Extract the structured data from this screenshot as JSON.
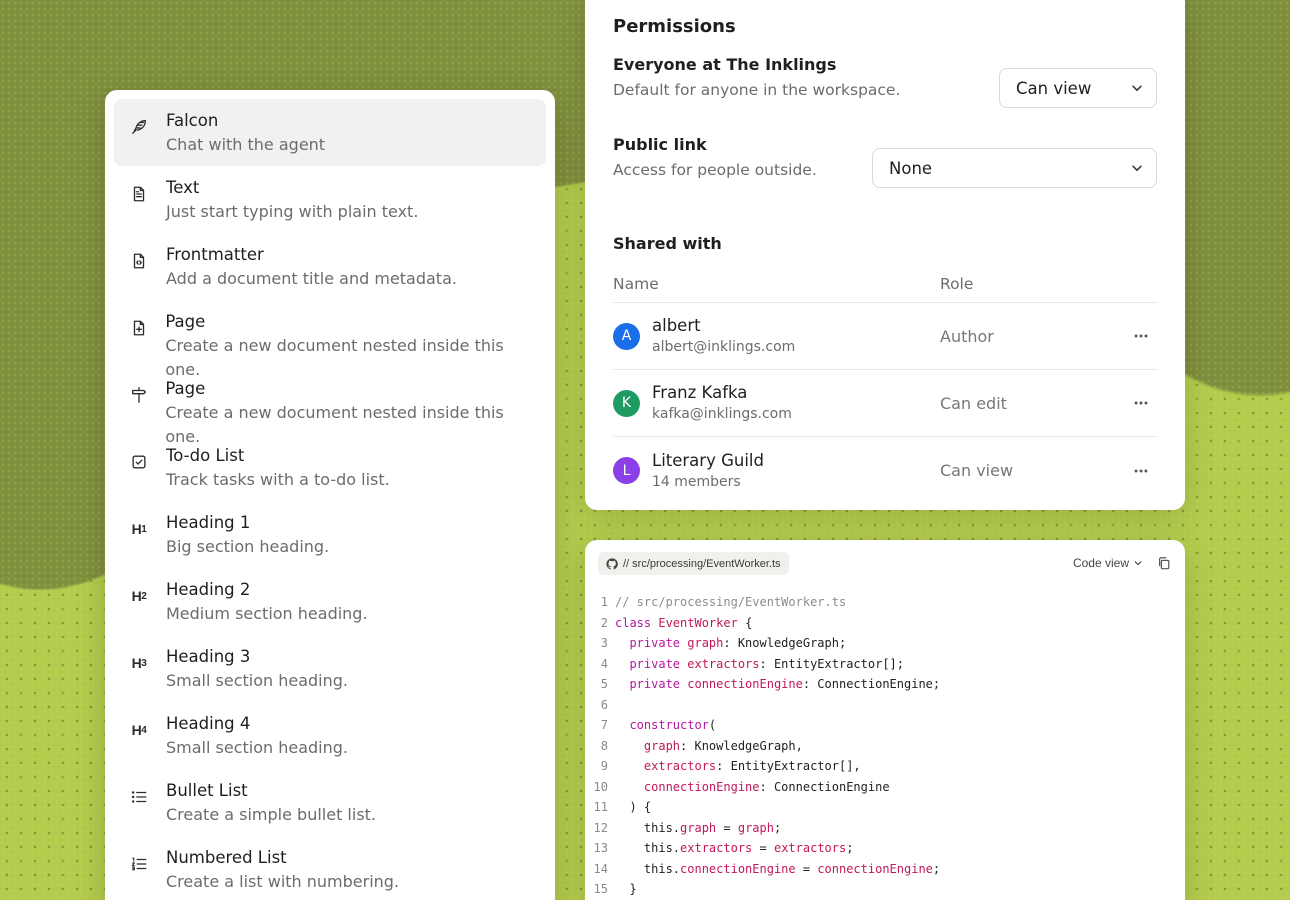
{
  "menu": {
    "items": [
      {
        "title": "Falcon",
        "desc": "Chat with the agent",
        "icon": "feather-icon",
        "active": true
      },
      {
        "title": "Text",
        "desc": "Just start typing with plain text.",
        "icon": "document-text-icon"
      },
      {
        "title": "Frontmatter",
        "desc": "Add a document title and metadata.",
        "icon": "document-code-icon"
      },
      {
        "title": "Page",
        "desc": "Create a new document nested inside this one.",
        "icon": "document-plus-icon"
      },
      {
        "title": "Page",
        "desc": "Create a new document nested inside this one.",
        "icon": "signpost-icon"
      },
      {
        "title": "To-do List",
        "desc": "Track tasks with a to-do list.",
        "icon": "checkbox-icon"
      },
      {
        "title": "Heading 1",
        "desc": "Big section heading.",
        "icon": "heading-1-icon",
        "glyph": "H",
        "sub": "1"
      },
      {
        "title": "Heading 2",
        "desc": "Medium section heading.",
        "icon": "heading-2-icon",
        "glyph": "H",
        "sub": "2"
      },
      {
        "title": "Heading 3",
        "desc": "Small section heading.",
        "icon": "heading-3-icon",
        "glyph": "H",
        "sub": "3"
      },
      {
        "title": "Heading 4",
        "desc": "Small section heading.",
        "icon": "heading-4-icon",
        "glyph": "H",
        "sub": "4"
      },
      {
        "title": "Bullet List",
        "desc": "Create a simple bullet list.",
        "icon": "bullet-list-icon"
      },
      {
        "title": "Numbered List",
        "desc": "Create a list with numbering.",
        "icon": "numbered-list-icon"
      }
    ]
  },
  "permissions": {
    "title": "Permissions",
    "workspace": {
      "title": "Everyone at The Inklings",
      "desc": "Default for anyone in the workspace.",
      "value": "Can view"
    },
    "public_link": {
      "title": "Public link",
      "desc": "Access for people outside.",
      "value": "None"
    },
    "shared_title": "Shared with",
    "columns": {
      "name": "Name",
      "role": "Role"
    },
    "rows": [
      {
        "initial": "A",
        "name": "albert",
        "sub": "albert@inklings.com",
        "role": "Author",
        "color": "#1a6ee8"
      },
      {
        "initial": "K",
        "name": "Franz Kafka",
        "sub": "kafka@inklings.com",
        "role": "Can edit",
        "color": "#1f9a63"
      },
      {
        "initial": "L",
        "name": "Literary Guild",
        "sub": "14 members",
        "role": "Can view",
        "color": "#8b3fe6"
      }
    ]
  },
  "code": {
    "path": "// src/processing/EventWorker.ts",
    "view_label": "Code view",
    "lines": [
      {
        "n": "1",
        "parts": [
          {
            "t": "// src/processing/EventWorker.ts",
            "c": "cm"
          }
        ]
      },
      {
        "n": "2",
        "parts": [
          {
            "t": "class ",
            "c": "kw"
          },
          {
            "t": "EventWorker",
            "c": "cn"
          },
          {
            "t": " {",
            "c": "tx"
          }
        ]
      },
      {
        "n": "3",
        "parts": [
          {
            "t": "  private ",
            "c": "kw"
          },
          {
            "t": "graph",
            "c": "cn"
          },
          {
            "t": ": KnowledgeGraph;",
            "c": "tx"
          }
        ]
      },
      {
        "n": "4",
        "parts": [
          {
            "t": "  private ",
            "c": "kw"
          },
          {
            "t": "extractors",
            "c": "cn"
          },
          {
            "t": ": EntityExtractor[];",
            "c": "tx"
          }
        ]
      },
      {
        "n": "5",
        "parts": [
          {
            "t": "  private ",
            "c": "kw"
          },
          {
            "t": "connectionEngine",
            "c": "cn"
          },
          {
            "t": ": ConnectionEngine;",
            "c": "tx"
          }
        ]
      },
      {
        "n": "6",
        "parts": []
      },
      {
        "n": "7",
        "parts": [
          {
            "t": "  constructor",
            "c": "kw"
          },
          {
            "t": "(",
            "c": "tx"
          }
        ]
      },
      {
        "n": "8",
        "parts": [
          {
            "t": "    graph",
            "c": "cn"
          },
          {
            "t": ": KnowledgeGraph,",
            "c": "tx"
          }
        ]
      },
      {
        "n": "9",
        "parts": [
          {
            "t": "    extractors",
            "c": "cn"
          },
          {
            "t": ": EntityExtractor[],",
            "c": "tx"
          }
        ]
      },
      {
        "n": "10",
        "parts": [
          {
            "t": "    connectionEngine",
            "c": "cn"
          },
          {
            "t": ": ConnectionEngine",
            "c": "tx"
          }
        ]
      },
      {
        "n": "11",
        "parts": [
          {
            "t": "  ) {",
            "c": "tx"
          }
        ]
      },
      {
        "n": "12",
        "parts": [
          {
            "t": "    this.",
            "c": "tx"
          },
          {
            "t": "graph",
            "c": "cn"
          },
          {
            "t": " = ",
            "c": "tx"
          },
          {
            "t": "graph",
            "c": "cn"
          },
          {
            "t": ";",
            "c": "tx"
          }
        ]
      },
      {
        "n": "13",
        "parts": [
          {
            "t": "    this.",
            "c": "tx"
          },
          {
            "t": "extractors",
            "c": "cn"
          },
          {
            "t": " = ",
            "c": "tx"
          },
          {
            "t": "extractors",
            "c": "cn"
          },
          {
            "t": ";",
            "c": "tx"
          }
        ]
      },
      {
        "n": "14",
        "parts": [
          {
            "t": "    this.",
            "c": "tx"
          },
          {
            "t": "connectionEngine",
            "c": "cn"
          },
          {
            "t": " = ",
            "c": "tx"
          },
          {
            "t": "connectionEngine",
            "c": "cn"
          },
          {
            "t": ";",
            "c": "tx"
          }
        ]
      },
      {
        "n": "15",
        "parts": [
          {
            "t": "  }",
            "c": "tx"
          }
        ]
      }
    ]
  }
}
